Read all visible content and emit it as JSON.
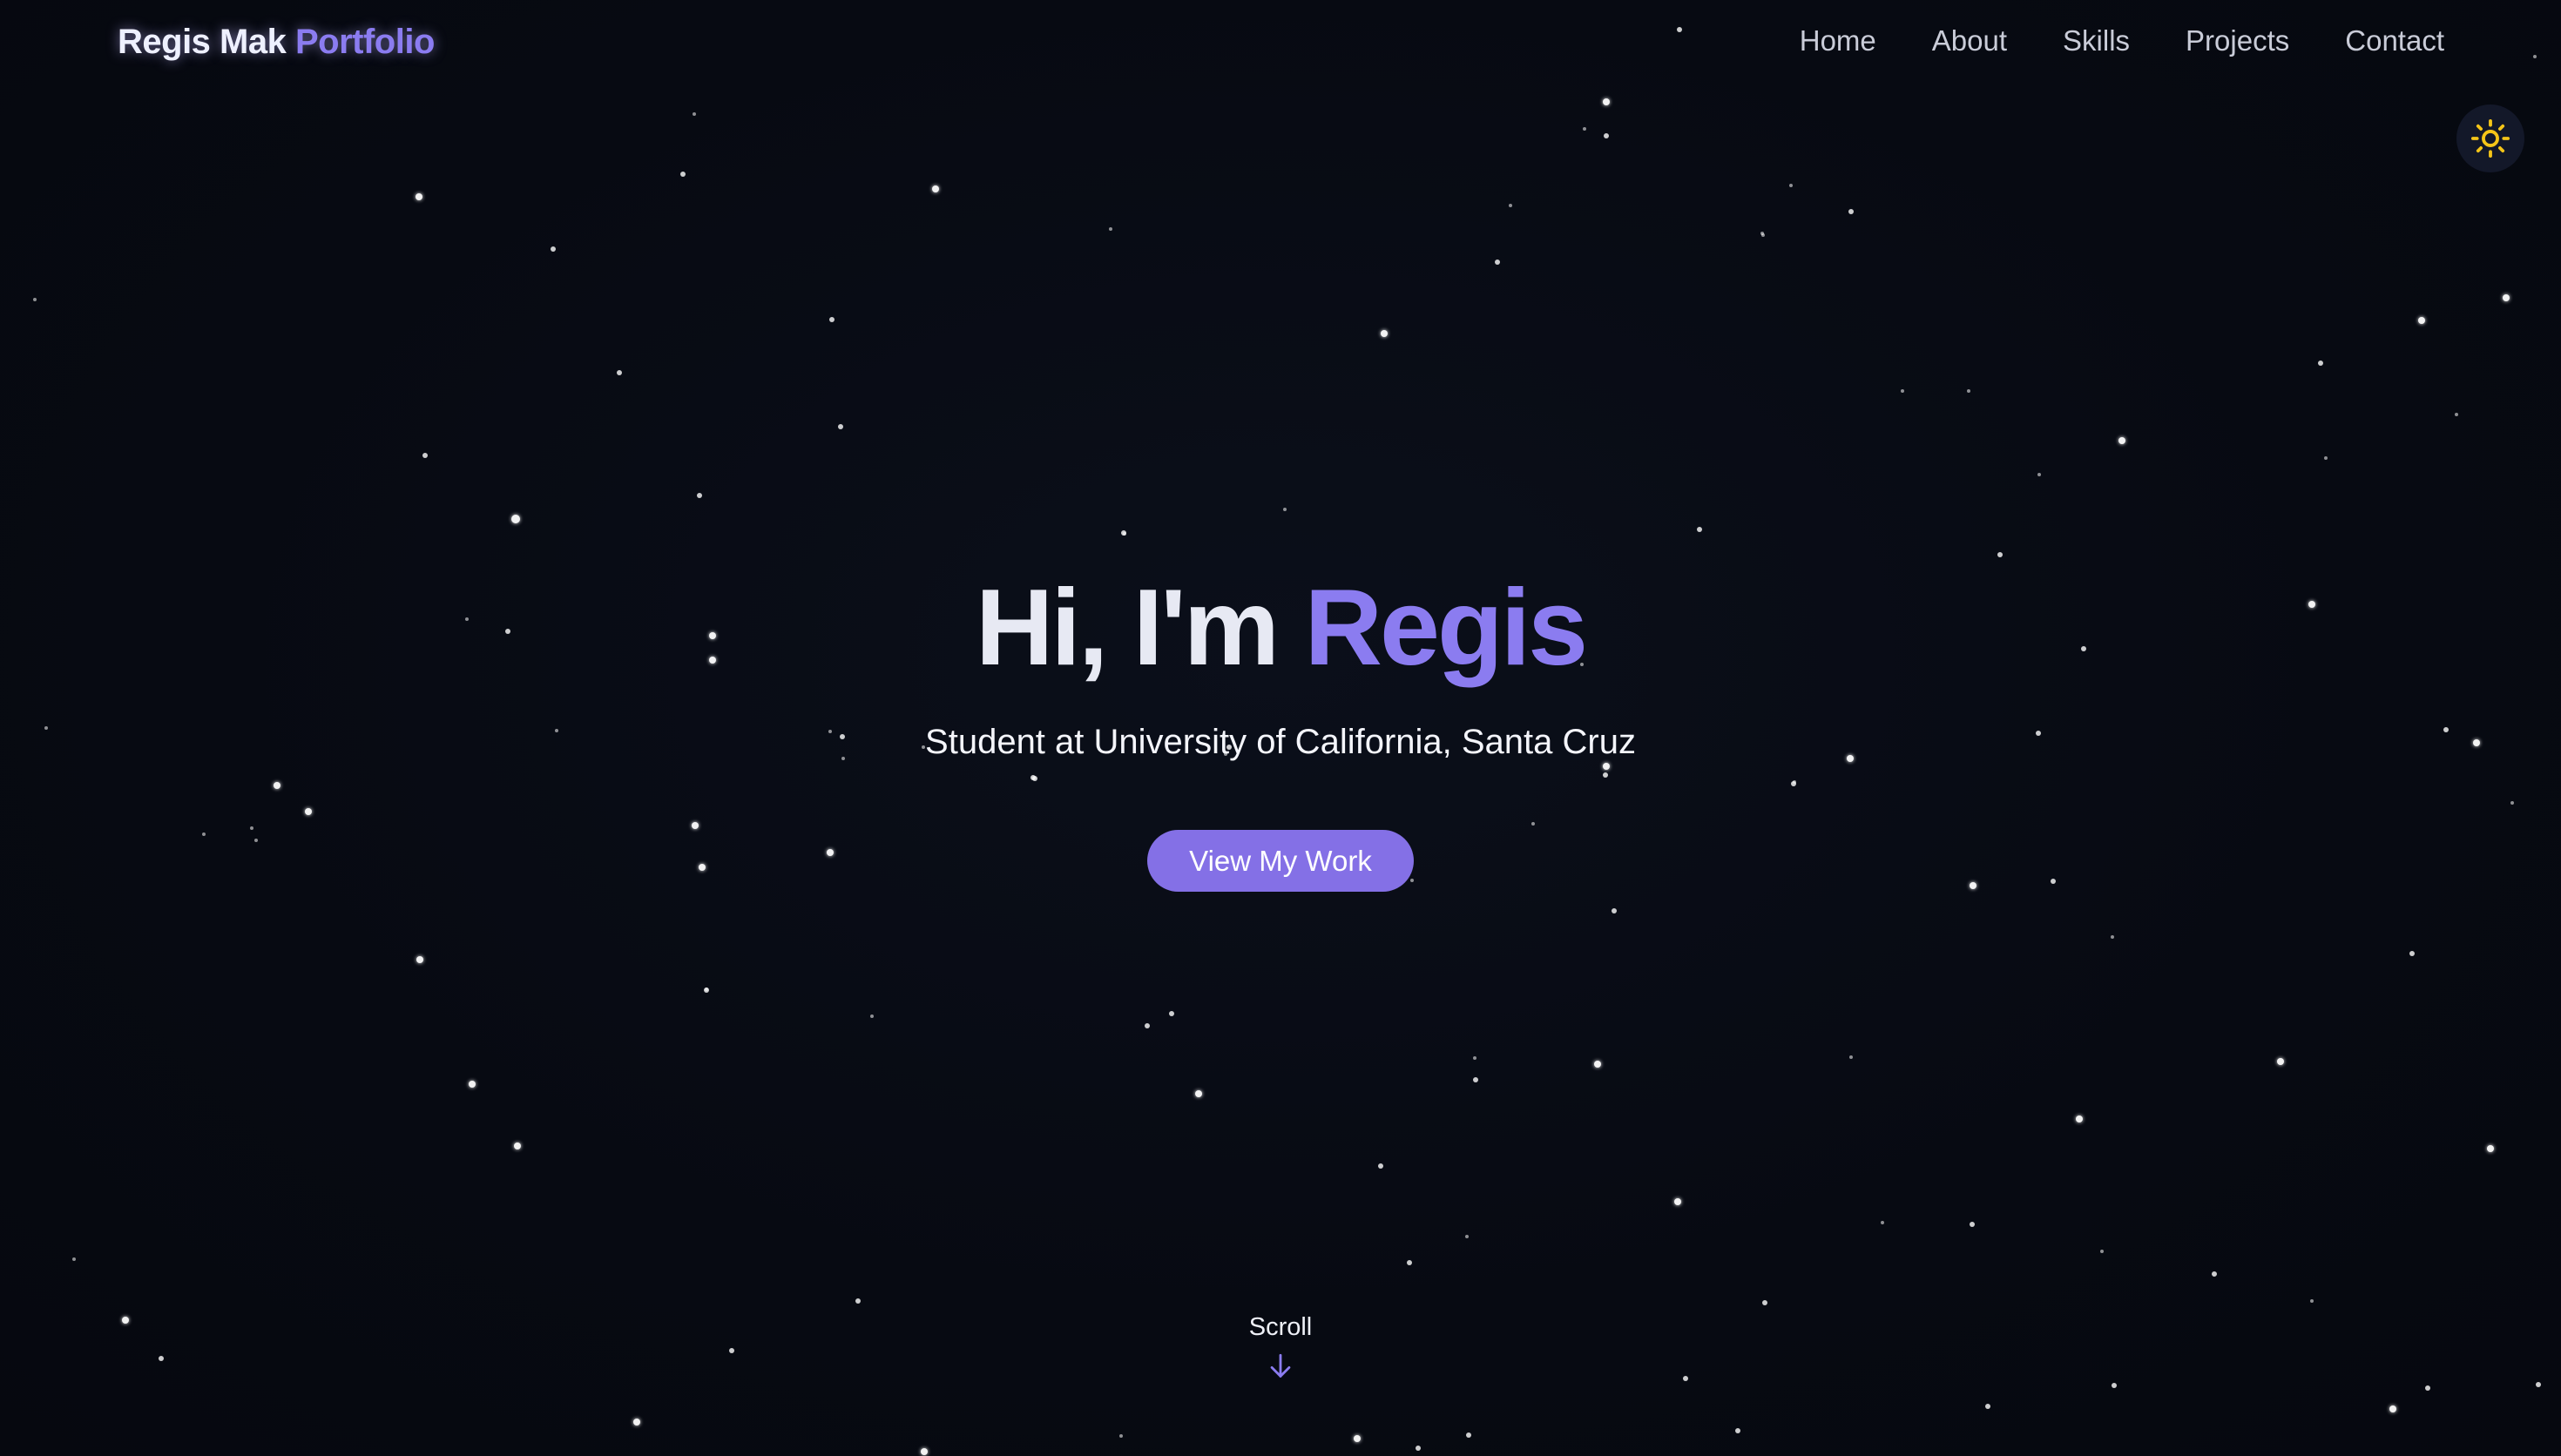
{
  "header": {
    "brand_name": "Regis Mak",
    "brand_accent": "Portfolio",
    "nav": [
      {
        "label": "Home"
      },
      {
        "label": "About"
      },
      {
        "label": "Skills"
      },
      {
        "label": "Projects"
      },
      {
        "label": "Contact"
      }
    ],
    "theme_toggle_icon": "sun-icon"
  },
  "hero": {
    "greeting": "Hi, I'm",
    "name": "Regis",
    "subtitle": "Student at University of California, Santa Cruz",
    "cta_label": "View My Work"
  },
  "scroll_indicator": {
    "label": "Scroll",
    "icon": "arrow-down-icon"
  },
  "colors": {
    "background": "#070a12",
    "accent": "#8b7cf0",
    "button": "#8470e6",
    "sun": "#f5c518"
  }
}
